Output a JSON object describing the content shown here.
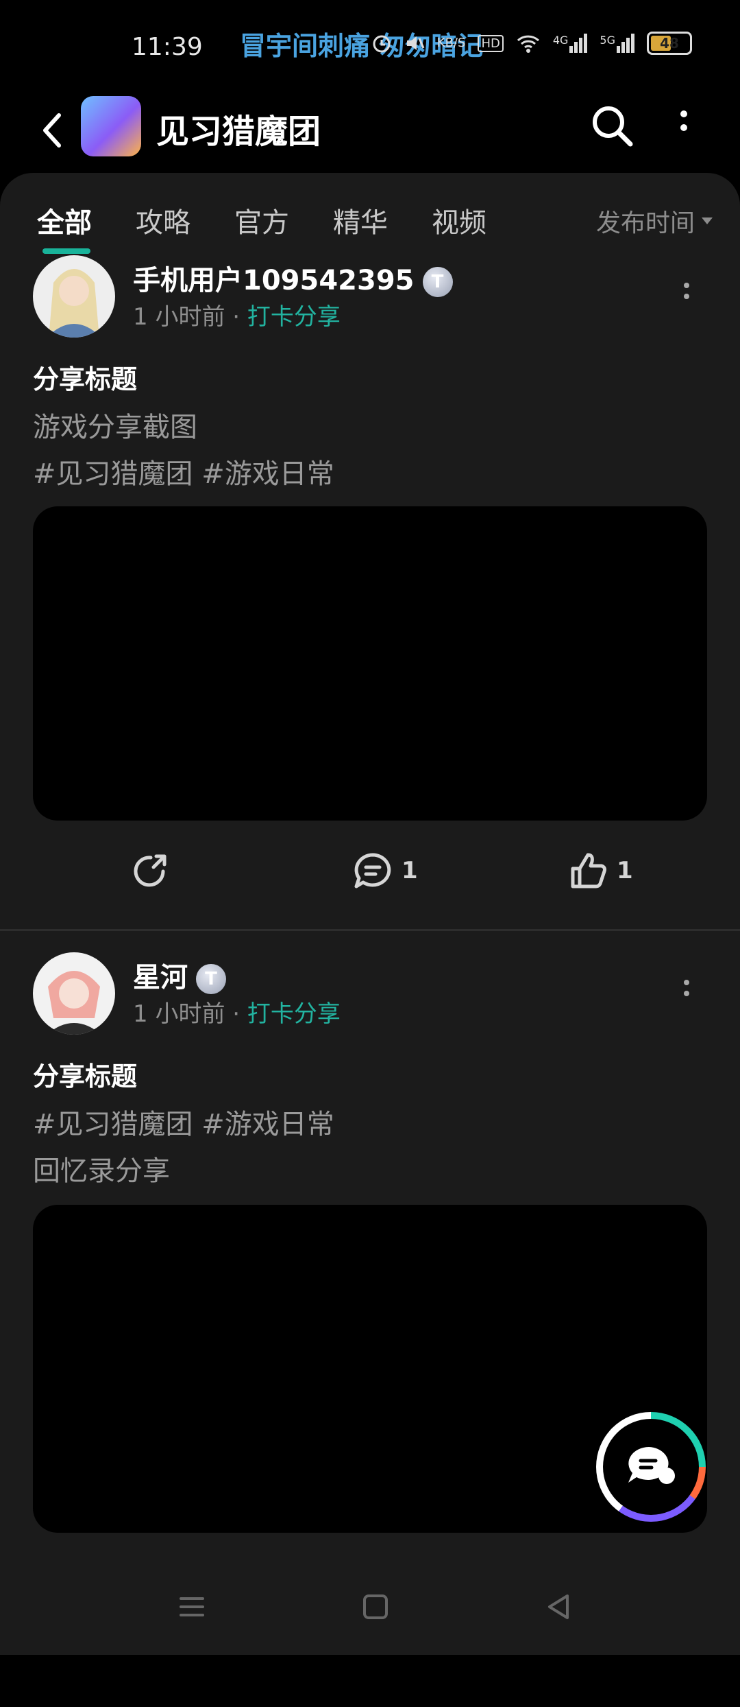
{
  "status_bar": {
    "time": "11:39",
    "marquee": "冒宇间刺痛 匆匆暗记",
    "icons": [
      "alarm-icon",
      "mute-icon",
      "kbs-indicator",
      "hd-icon",
      "wifi-icon",
      "signal-4g-icon",
      "signal-5g-icon"
    ],
    "speed_label": "KB/S",
    "hd_label": "HD",
    "net4g": "4G",
    "net5g": "5G",
    "battery": "48"
  },
  "header": {
    "title": "见习猎魔团",
    "icons": [
      "back-icon",
      "game-app-icon",
      "search-icon",
      "more-vertical-icon"
    ]
  },
  "tabs": {
    "items": [
      "全部",
      "攻略",
      "官方",
      "精华",
      "视频"
    ],
    "active": "全部",
    "sort_label": "发布时间"
  },
  "posts": [
    {
      "user": "手机用户109542395",
      "badge": "T",
      "time": "1 小时前",
      "sep": "·",
      "category": "打卡分享",
      "title": "分享标题",
      "lines": [
        "游戏分享截图",
        "#见习猎魔团 #游戏日常"
      ],
      "comments": "1",
      "likes": "1"
    },
    {
      "user": "星河",
      "badge": "T",
      "time": "1 小时前",
      "sep": "·",
      "category": "打卡分享",
      "title": "分享标题",
      "lines": [
        "#见习猎魔团 #游戏日常",
        "回忆录分享"
      ]
    }
  ],
  "colors": {
    "accent": "#19b39a",
    "category": "#22b3a0",
    "panel": "#1b1b1b",
    "marquee": "#4aa3e0"
  },
  "navbar": {
    "icons": [
      "menu-lines-icon",
      "home-square-icon",
      "back-triangle-icon"
    ]
  }
}
